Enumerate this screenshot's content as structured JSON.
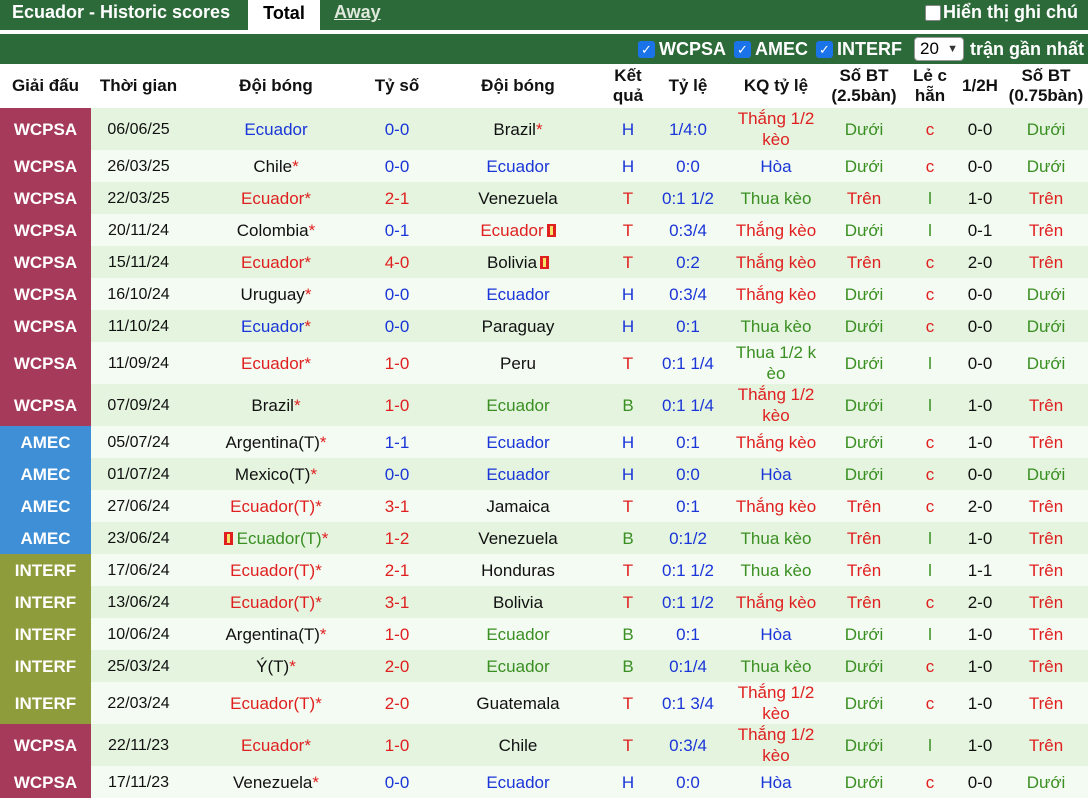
{
  "header": {
    "title": "Ecuador - Historic scores",
    "tabs": [
      "Total",
      "Away"
    ],
    "hidden_toggle_label": "Hiển thị ghi chú"
  },
  "filters": {
    "items": [
      {
        "label": "WCPSA",
        "checked": true
      },
      {
        "label": "AMEC",
        "checked": true
      },
      {
        "label": "INTERF",
        "checked": true
      }
    ],
    "count_value": "20",
    "count_label": "trận gần nhất"
  },
  "colors": {
    "header_green": "#2d6a3a",
    "WCPSA": "#a63a5b",
    "AMEC": "#3f8fd6",
    "INTERF": "#8f9c3c",
    "row_odd": "#e4f4df",
    "row_even": "#f4fbf2"
  },
  "table": {
    "columns": [
      "Giải đấu",
      "Thời gian",
      "Đội bóng",
      "Tỷ số",
      "Đội bóng",
      "Kết quả",
      "Tỷ lệ",
      "KQ tỷ lệ",
      "Số BT (2.5bàn)",
      "Lẻ c hẵn",
      "1/2H",
      "Số BT (0.75bàn)"
    ],
    "rows": [
      {
        "league": "WCPSA",
        "date": "06/06/25",
        "home": "Ecuador",
        "home_color": "blue",
        "home_star": false,
        "away": "Brazil",
        "away_color": "black",
        "away_star": true,
        "score": "0-0",
        "score_color": "blue",
        "result": "H",
        "result_color": "blue",
        "odds": "1/4:0",
        "odds_result": "Thắng 1/2 kèo",
        "odds_result_color": "red",
        "ou": "Dưới",
        "ou_color": "green",
        "oe": "c",
        "oe_color": "red",
        "ht": "0-0",
        "ou2": "Dưới",
        "ou2_color": "green",
        "tall": true
      },
      {
        "league": "WCPSA",
        "date": "26/03/25",
        "home": "Chile",
        "home_color": "black",
        "home_star": true,
        "away": "Ecuador",
        "away_color": "blue",
        "away_star": false,
        "score": "0-0",
        "score_color": "blue",
        "result": "H",
        "result_color": "blue",
        "odds": "0:0",
        "odds_result": "Hòa",
        "odds_result_color": "blue",
        "ou": "Dưới",
        "ou_color": "green",
        "oe": "c",
        "oe_color": "red",
        "ht": "0-0",
        "ou2": "Dưới",
        "ou2_color": "green"
      },
      {
        "league": "WCPSA",
        "date": "22/03/25",
        "home": "Ecuador",
        "home_color": "red",
        "home_star": true,
        "away": "Venezuela",
        "away_color": "black",
        "away_star": false,
        "score": "2-1",
        "score_color": "red",
        "result": "T",
        "result_color": "red",
        "odds": "0:1 1/2",
        "odds_result": "Thua kèo",
        "odds_result_color": "green",
        "ou": "Trên",
        "ou_color": "red",
        "oe": "l",
        "oe_color": "green",
        "ht": "1-0",
        "ou2": "Trên",
        "ou2_color": "red"
      },
      {
        "league": "WCPSA",
        "date": "20/11/24",
        "home": "Colombia",
        "home_color": "black",
        "home_star": true,
        "away": "Ecuador",
        "away_color": "red",
        "away_star": false,
        "away_card": true,
        "score": "0-1",
        "score_color": "blue",
        "result": "T",
        "result_color": "red",
        "odds": "0:3/4",
        "odds_result": "Thắng kèo",
        "odds_result_color": "red",
        "ou": "Dưới",
        "ou_color": "green",
        "oe": "l",
        "oe_color": "green",
        "ht": "0-1",
        "ou2": "Trên",
        "ou2_color": "red"
      },
      {
        "league": "WCPSA",
        "date": "15/11/24",
        "home": "Ecuador",
        "home_color": "red",
        "home_star": true,
        "away": "Bolivia",
        "away_color": "black",
        "away_star": false,
        "away_card": true,
        "score": "4-0",
        "score_color": "red",
        "result": "T",
        "result_color": "red",
        "odds": "0:2",
        "odds_result": "Thắng kèo",
        "odds_result_color": "red",
        "ou": "Trên",
        "ou_color": "red",
        "oe": "c",
        "oe_color": "red",
        "ht": "2-0",
        "ou2": "Trên",
        "ou2_color": "red"
      },
      {
        "league": "WCPSA",
        "date": "16/10/24",
        "home": "Uruguay",
        "home_color": "black",
        "home_star": true,
        "away": "Ecuador",
        "away_color": "blue",
        "away_star": false,
        "score": "0-0",
        "score_color": "blue",
        "result": "H",
        "result_color": "blue",
        "odds": "0:3/4",
        "odds_result": "Thắng kèo",
        "odds_result_color": "red",
        "ou": "Dưới",
        "ou_color": "green",
        "oe": "c",
        "oe_color": "red",
        "ht": "0-0",
        "ou2": "Dưới",
        "ou2_color": "green"
      },
      {
        "league": "WCPSA",
        "date": "11/10/24",
        "home": "Ecuador",
        "home_color": "blue",
        "home_star": true,
        "away": "Paraguay",
        "away_color": "black",
        "away_star": false,
        "score": "0-0",
        "score_color": "blue",
        "result": "H",
        "result_color": "blue",
        "odds": "0:1",
        "odds_result": "Thua kèo",
        "odds_result_color": "green",
        "ou": "Dưới",
        "ou_color": "green",
        "oe": "c",
        "oe_color": "red",
        "ht": "0-0",
        "ou2": "Dưới",
        "ou2_color": "green"
      },
      {
        "league": "WCPSA",
        "date": "11/09/24",
        "home": "Ecuador",
        "home_color": "red",
        "home_star": true,
        "away": "Peru",
        "away_color": "black",
        "away_star": false,
        "score": "1-0",
        "score_color": "red",
        "result": "T",
        "result_color": "red",
        "odds": "0:1 1/4",
        "odds_result": "Thua 1/2 k èo",
        "odds_result_color": "green",
        "ou": "Dưới",
        "ou_color": "green",
        "oe": "l",
        "oe_color": "green",
        "ht": "0-0",
        "ou2": "Dưới",
        "ou2_color": "green",
        "tall": true
      },
      {
        "league": "WCPSA",
        "date": "07/09/24",
        "home": "Brazil",
        "home_color": "black",
        "home_star": true,
        "away": "Ecuador",
        "away_color": "green",
        "away_star": false,
        "score": "1-0",
        "score_color": "red",
        "result": "B",
        "result_color": "green",
        "odds": "0:1 1/4",
        "odds_result": "Thắng 1/2 kèo",
        "odds_result_color": "red",
        "ou": "Dưới",
        "ou_color": "green",
        "oe": "l",
        "oe_color": "green",
        "ht": "1-0",
        "ou2": "Trên",
        "ou2_color": "red",
        "tall": true
      },
      {
        "league": "AMEC",
        "date": "05/07/24",
        "home": "Argentina(T)",
        "home_color": "black",
        "home_star": true,
        "away": "Ecuador",
        "away_color": "blue",
        "away_star": false,
        "score": "1-1",
        "score_color": "blue",
        "result": "H",
        "result_color": "blue",
        "odds": "0:1",
        "odds_result": "Thắng kèo",
        "odds_result_color": "red",
        "ou": "Dưới",
        "ou_color": "green",
        "oe": "c",
        "oe_color": "red",
        "ht": "1-0",
        "ou2": "Trên",
        "ou2_color": "red"
      },
      {
        "league": "AMEC",
        "date": "01/07/24",
        "home": "Mexico(T)",
        "home_color": "black",
        "home_star": true,
        "away": "Ecuador",
        "away_color": "blue",
        "away_star": false,
        "score": "0-0",
        "score_color": "blue",
        "result": "H",
        "result_color": "blue",
        "odds": "0:0",
        "odds_result": "Hòa",
        "odds_result_color": "blue",
        "ou": "Dưới",
        "ou_color": "green",
        "oe": "c",
        "oe_color": "red",
        "ht": "0-0",
        "ou2": "Dưới",
        "ou2_color": "green"
      },
      {
        "league": "AMEC",
        "date": "27/06/24",
        "home": "Ecuador(T)",
        "home_color": "red",
        "home_star": true,
        "away": "Jamaica",
        "away_color": "black",
        "away_star": false,
        "score": "3-1",
        "score_color": "red",
        "result": "T",
        "result_color": "red",
        "odds": "0:1",
        "odds_result": "Thắng kèo",
        "odds_result_color": "red",
        "ou": "Trên",
        "ou_color": "red",
        "oe": "c",
        "oe_color": "red",
        "ht": "2-0",
        "ou2": "Trên",
        "ou2_color": "red"
      },
      {
        "league": "AMEC",
        "date": "23/06/24",
        "home": "Ecuador(T)",
        "home_color": "green",
        "home_star": true,
        "home_card": true,
        "away": "Venezuela",
        "away_color": "black",
        "away_star": false,
        "score": "1-2",
        "score_color": "red",
        "result": "B",
        "result_color": "green",
        "odds": "0:1/2",
        "odds_result": "Thua kèo",
        "odds_result_color": "green",
        "ou": "Trên",
        "ou_color": "red",
        "oe": "l",
        "oe_color": "green",
        "ht": "1-0",
        "ou2": "Trên",
        "ou2_color": "red"
      },
      {
        "league": "INTERF",
        "date": "17/06/24",
        "home": "Ecuador(T)",
        "home_color": "red",
        "home_star": true,
        "away": "Honduras",
        "away_color": "black",
        "away_star": false,
        "score": "2-1",
        "score_color": "red",
        "result": "T",
        "result_color": "red",
        "odds": "0:1 1/2",
        "odds_result": "Thua kèo",
        "odds_result_color": "green",
        "ou": "Trên",
        "ou_color": "red",
        "oe": "l",
        "oe_color": "green",
        "ht": "1-1",
        "ou2": "Trên",
        "ou2_color": "red"
      },
      {
        "league": "INTERF",
        "date": "13/06/24",
        "home": "Ecuador(T)",
        "home_color": "red",
        "home_star": true,
        "away": "Bolivia",
        "away_color": "black",
        "away_star": false,
        "score": "3-1",
        "score_color": "red",
        "result": "T",
        "result_color": "red",
        "odds": "0:1 1/2",
        "odds_result": "Thắng kèo",
        "odds_result_color": "red",
        "ou": "Trên",
        "ou_color": "red",
        "oe": "c",
        "oe_color": "red",
        "ht": "2-0",
        "ou2": "Trên",
        "ou2_color": "red"
      },
      {
        "league": "INTERF",
        "date": "10/06/24",
        "home": "Argentina(T)",
        "home_color": "black",
        "home_star": true,
        "away": "Ecuador",
        "away_color": "green",
        "away_star": false,
        "score": "1-0",
        "score_color": "red",
        "result": "B",
        "result_color": "green",
        "odds": "0:1",
        "odds_result": "Hòa",
        "odds_result_color": "blue",
        "ou": "Dưới",
        "ou_color": "green",
        "oe": "l",
        "oe_color": "green",
        "ht": "1-0",
        "ou2": "Trên",
        "ou2_color": "red"
      },
      {
        "league": "INTERF",
        "date": "25/03/24",
        "home": "Ý(T)",
        "home_color": "black",
        "home_star": true,
        "away": "Ecuador",
        "away_color": "green",
        "away_star": false,
        "score": "2-0",
        "score_color": "red",
        "result": "B",
        "result_color": "green",
        "odds": "0:1/4",
        "odds_result": "Thua kèo",
        "odds_result_color": "green",
        "ou": "Dưới",
        "ou_color": "green",
        "oe": "c",
        "oe_color": "red",
        "ht": "1-0",
        "ou2": "Trên",
        "ou2_color": "red"
      },
      {
        "league": "INTERF",
        "date": "22/03/24",
        "home": "Ecuador(T)",
        "home_color": "red",
        "home_star": true,
        "away": "Guatemala",
        "away_color": "black",
        "away_star": false,
        "score": "2-0",
        "score_color": "red",
        "result": "T",
        "result_color": "red",
        "odds": "0:1 3/4",
        "odds_result": "Thắng 1/2 kèo",
        "odds_result_color": "red",
        "ou": "Dưới",
        "ou_color": "green",
        "oe": "c",
        "oe_color": "red",
        "ht": "1-0",
        "ou2": "Trên",
        "ou2_color": "red",
        "tall": true
      },
      {
        "league": "WCPSA",
        "date": "22/11/23",
        "home": "Ecuador",
        "home_color": "red",
        "home_star": true,
        "away": "Chile",
        "away_color": "black",
        "away_star": false,
        "score": "1-0",
        "score_color": "red",
        "result": "T",
        "result_color": "red",
        "odds": "0:3/4",
        "odds_result": "Thắng 1/2 kèo",
        "odds_result_color": "red",
        "ou": "Dưới",
        "ou_color": "green",
        "oe": "l",
        "oe_color": "green",
        "ht": "1-0",
        "ou2": "Trên",
        "ou2_color": "red",
        "tall": true
      },
      {
        "league": "WCPSA",
        "date": "17/11/23",
        "home": "Venezuela",
        "home_color": "black",
        "home_star": true,
        "away": "Ecuador",
        "away_color": "blue",
        "away_star": false,
        "score": "0-0",
        "score_color": "blue",
        "result": "H",
        "result_color": "blue",
        "odds": "0:0",
        "odds_result": "Hòa",
        "odds_result_color": "blue",
        "ou": "Dưới",
        "ou_color": "green",
        "oe": "c",
        "oe_color": "red",
        "ht": "0-0",
        "ou2": "Dưới",
        "ou2_color": "green"
      }
    ]
  }
}
